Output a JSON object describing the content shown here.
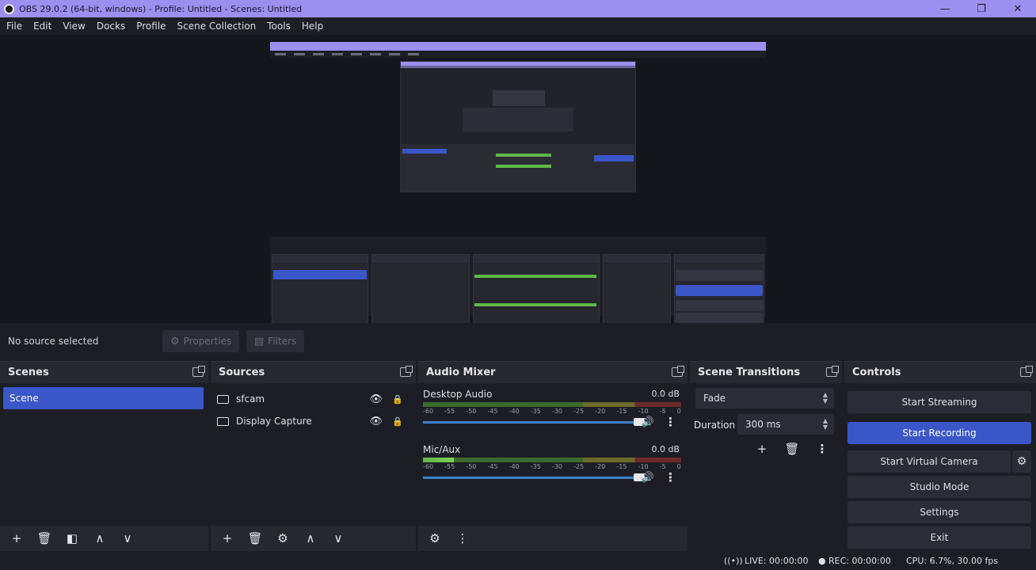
{
  "window": {
    "title": "OBS 29.0.2 (64-bit, windows) - Profile: Untitled - Scenes: Untitled",
    "controls": [
      "—",
      "❐",
      "✕"
    ]
  },
  "menu": [
    "File",
    "Edit",
    "View",
    "Docks",
    "Profile",
    "Scene Collection",
    "Tools",
    "Help"
  ],
  "source_toolbar": {
    "status": "No source selected",
    "properties_label": "Properties",
    "filters_label": "Filters"
  },
  "scenes": {
    "title": "Scenes",
    "items": [
      "Scene"
    ]
  },
  "sources": {
    "title": "Sources",
    "items": [
      "sfcam",
      "Display Capture"
    ]
  },
  "audio_mixer": {
    "title": "Audio Mixer",
    "channels": [
      {
        "name": "Desktop Audio",
        "db": "0.0 dB",
        "level": 0.0
      },
      {
        "name": "Mic/Aux",
        "db": "0.0 dB",
        "level": 0.12
      }
    ],
    "ticks": [
      "-60",
      "-55",
      "-50",
      "-45",
      "-40",
      "-35",
      "-30",
      "-25",
      "-20",
      "-15",
      "-10",
      "-5",
      "0"
    ]
  },
  "transitions": {
    "title": "Scene Transitions",
    "transition": "Fade",
    "duration_label": "Duration",
    "duration_value": "300 ms"
  },
  "controls": {
    "title": "Controls",
    "start_streaming": "Start Streaming",
    "start_recording": "Start Recording",
    "start_virtual_camera": "Start Virtual Camera",
    "studio_mode": "Studio Mode",
    "settings": "Settings",
    "exit": "Exit"
  },
  "status": {
    "live": "LIVE: 00:00:00",
    "rec": "REC: 00:00:00",
    "cpu": "CPU: 6.7%, 30.00 fps"
  }
}
